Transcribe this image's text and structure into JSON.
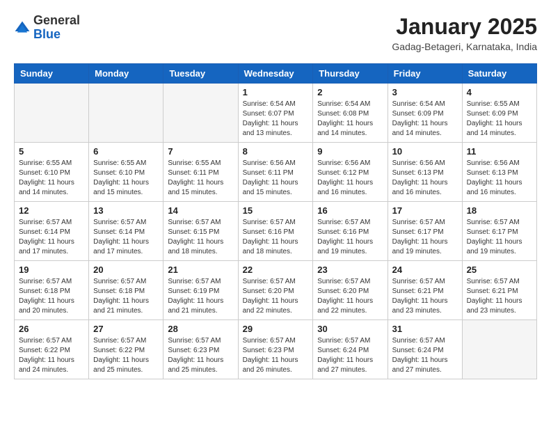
{
  "header": {
    "logo_general": "General",
    "logo_blue": "Blue",
    "month_title": "January 2025",
    "location": "Gadag-Betageri, Karnataka, India"
  },
  "weekdays": [
    "Sunday",
    "Monday",
    "Tuesday",
    "Wednesday",
    "Thursday",
    "Friday",
    "Saturday"
  ],
  "weeks": [
    [
      {
        "day": "",
        "sunrise": "",
        "sunset": "",
        "daylight": "",
        "empty": true
      },
      {
        "day": "",
        "sunrise": "",
        "sunset": "",
        "daylight": "",
        "empty": true
      },
      {
        "day": "",
        "sunrise": "",
        "sunset": "",
        "daylight": "",
        "empty": true
      },
      {
        "day": "1",
        "sunrise": "Sunrise: 6:54 AM",
        "sunset": "Sunset: 6:07 PM",
        "daylight": "Daylight: 11 hours and 13 minutes.",
        "empty": false
      },
      {
        "day": "2",
        "sunrise": "Sunrise: 6:54 AM",
        "sunset": "Sunset: 6:08 PM",
        "daylight": "Daylight: 11 hours and 14 minutes.",
        "empty": false
      },
      {
        "day": "3",
        "sunrise": "Sunrise: 6:54 AM",
        "sunset": "Sunset: 6:09 PM",
        "daylight": "Daylight: 11 hours and 14 minutes.",
        "empty": false
      },
      {
        "day": "4",
        "sunrise": "Sunrise: 6:55 AM",
        "sunset": "Sunset: 6:09 PM",
        "daylight": "Daylight: 11 hours and 14 minutes.",
        "empty": false
      }
    ],
    [
      {
        "day": "5",
        "sunrise": "Sunrise: 6:55 AM",
        "sunset": "Sunset: 6:10 PM",
        "daylight": "Daylight: 11 hours and 14 minutes.",
        "empty": false
      },
      {
        "day": "6",
        "sunrise": "Sunrise: 6:55 AM",
        "sunset": "Sunset: 6:10 PM",
        "daylight": "Daylight: 11 hours and 15 minutes.",
        "empty": false
      },
      {
        "day": "7",
        "sunrise": "Sunrise: 6:55 AM",
        "sunset": "Sunset: 6:11 PM",
        "daylight": "Daylight: 11 hours and 15 minutes.",
        "empty": false
      },
      {
        "day": "8",
        "sunrise": "Sunrise: 6:56 AM",
        "sunset": "Sunset: 6:11 PM",
        "daylight": "Daylight: 11 hours and 15 minutes.",
        "empty": false
      },
      {
        "day": "9",
        "sunrise": "Sunrise: 6:56 AM",
        "sunset": "Sunset: 6:12 PM",
        "daylight": "Daylight: 11 hours and 16 minutes.",
        "empty": false
      },
      {
        "day": "10",
        "sunrise": "Sunrise: 6:56 AM",
        "sunset": "Sunset: 6:13 PM",
        "daylight": "Daylight: 11 hours and 16 minutes.",
        "empty": false
      },
      {
        "day": "11",
        "sunrise": "Sunrise: 6:56 AM",
        "sunset": "Sunset: 6:13 PM",
        "daylight": "Daylight: 11 hours and 16 minutes.",
        "empty": false
      }
    ],
    [
      {
        "day": "12",
        "sunrise": "Sunrise: 6:57 AM",
        "sunset": "Sunset: 6:14 PM",
        "daylight": "Daylight: 11 hours and 17 minutes.",
        "empty": false
      },
      {
        "day": "13",
        "sunrise": "Sunrise: 6:57 AM",
        "sunset": "Sunset: 6:14 PM",
        "daylight": "Daylight: 11 hours and 17 minutes.",
        "empty": false
      },
      {
        "day": "14",
        "sunrise": "Sunrise: 6:57 AM",
        "sunset": "Sunset: 6:15 PM",
        "daylight": "Daylight: 11 hours and 18 minutes.",
        "empty": false
      },
      {
        "day": "15",
        "sunrise": "Sunrise: 6:57 AM",
        "sunset": "Sunset: 6:16 PM",
        "daylight": "Daylight: 11 hours and 18 minutes.",
        "empty": false
      },
      {
        "day": "16",
        "sunrise": "Sunrise: 6:57 AM",
        "sunset": "Sunset: 6:16 PM",
        "daylight": "Daylight: 11 hours and 19 minutes.",
        "empty": false
      },
      {
        "day": "17",
        "sunrise": "Sunrise: 6:57 AM",
        "sunset": "Sunset: 6:17 PM",
        "daylight": "Daylight: 11 hours and 19 minutes.",
        "empty": false
      },
      {
        "day": "18",
        "sunrise": "Sunrise: 6:57 AM",
        "sunset": "Sunset: 6:17 PM",
        "daylight": "Daylight: 11 hours and 19 minutes.",
        "empty": false
      }
    ],
    [
      {
        "day": "19",
        "sunrise": "Sunrise: 6:57 AM",
        "sunset": "Sunset: 6:18 PM",
        "daylight": "Daylight: 11 hours and 20 minutes.",
        "empty": false
      },
      {
        "day": "20",
        "sunrise": "Sunrise: 6:57 AM",
        "sunset": "Sunset: 6:18 PM",
        "daylight": "Daylight: 11 hours and 21 minutes.",
        "empty": false
      },
      {
        "day": "21",
        "sunrise": "Sunrise: 6:57 AM",
        "sunset": "Sunset: 6:19 PM",
        "daylight": "Daylight: 11 hours and 21 minutes.",
        "empty": false
      },
      {
        "day": "22",
        "sunrise": "Sunrise: 6:57 AM",
        "sunset": "Sunset: 6:20 PM",
        "daylight": "Daylight: 11 hours and 22 minutes.",
        "empty": false
      },
      {
        "day": "23",
        "sunrise": "Sunrise: 6:57 AM",
        "sunset": "Sunset: 6:20 PM",
        "daylight": "Daylight: 11 hours and 22 minutes.",
        "empty": false
      },
      {
        "day": "24",
        "sunrise": "Sunrise: 6:57 AM",
        "sunset": "Sunset: 6:21 PM",
        "daylight": "Daylight: 11 hours and 23 minutes.",
        "empty": false
      },
      {
        "day": "25",
        "sunrise": "Sunrise: 6:57 AM",
        "sunset": "Sunset: 6:21 PM",
        "daylight": "Daylight: 11 hours and 23 minutes.",
        "empty": false
      }
    ],
    [
      {
        "day": "26",
        "sunrise": "Sunrise: 6:57 AM",
        "sunset": "Sunset: 6:22 PM",
        "daylight": "Daylight: 11 hours and 24 minutes.",
        "empty": false
      },
      {
        "day": "27",
        "sunrise": "Sunrise: 6:57 AM",
        "sunset": "Sunset: 6:22 PM",
        "daylight": "Daylight: 11 hours and 25 minutes.",
        "empty": false
      },
      {
        "day": "28",
        "sunrise": "Sunrise: 6:57 AM",
        "sunset": "Sunset: 6:23 PM",
        "daylight": "Daylight: 11 hours and 25 minutes.",
        "empty": false
      },
      {
        "day": "29",
        "sunrise": "Sunrise: 6:57 AM",
        "sunset": "Sunset: 6:23 PM",
        "daylight": "Daylight: 11 hours and 26 minutes.",
        "empty": false
      },
      {
        "day": "30",
        "sunrise": "Sunrise: 6:57 AM",
        "sunset": "Sunset: 6:24 PM",
        "daylight": "Daylight: 11 hours and 27 minutes.",
        "empty": false
      },
      {
        "day": "31",
        "sunrise": "Sunrise: 6:57 AM",
        "sunset": "Sunset: 6:24 PM",
        "daylight": "Daylight: 11 hours and 27 minutes.",
        "empty": false
      },
      {
        "day": "",
        "sunrise": "",
        "sunset": "",
        "daylight": "",
        "empty": true
      }
    ]
  ]
}
